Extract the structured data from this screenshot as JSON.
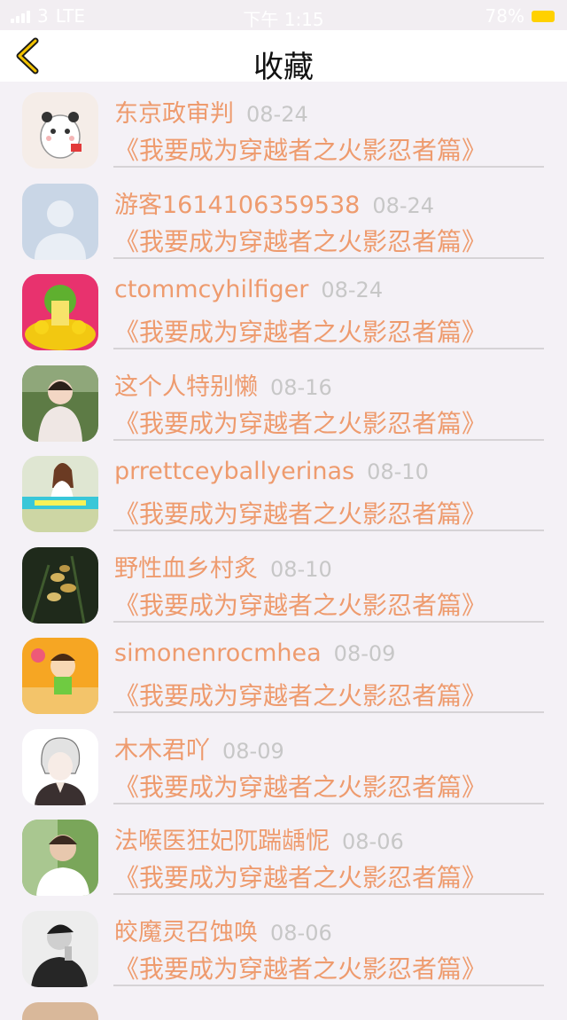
{
  "status": {
    "carrier": "3",
    "network": "LTE",
    "time": "下午 1:15",
    "battery": "78%"
  },
  "header": {
    "title": "收藏"
  },
  "colors": {
    "accent": "#ee9b6e",
    "date": "#c7c7c7",
    "battery": "#ffd100"
  },
  "items": [
    {
      "name": "东京政审判",
      "date": "08-24",
      "book": "《我要成为穿越者之火影忍者篇》",
      "avatar": "panda-sticker-avatar"
    },
    {
      "name": "游客1614106359538",
      "date": "08-24",
      "book": "《我要成为穿越者之火影忍者篇》",
      "avatar": "default-person-avatar"
    },
    {
      "name": "ctommcyhilfiger",
      "date": "08-24",
      "book": "《我要成为穿越者之火影忍者篇》",
      "avatar": "cartoon-plant-avatar"
    },
    {
      "name": "这个人特别懒",
      "date": "08-16",
      "book": "《我要成为穿越者之火影忍者篇》",
      "avatar": "girl-photo-avatar"
    },
    {
      "name": "prrettceyballyerinas",
      "date": "08-10",
      "book": "《我要成为穿越者之火影忍者篇》",
      "avatar": "girl-field-avatar"
    },
    {
      "name": "野性血乡村炙",
      "date": "08-10",
      "book": "《我要成为穿越者之火影忍者篇》",
      "avatar": "flower-avatar"
    },
    {
      "name": "simonenrocmhea",
      "date": "08-09",
      "book": "《我要成为穿越者之火影忍者篇》",
      "avatar": "cartoon-kid-avatar"
    },
    {
      "name": "木木君吖",
      "date": "08-09",
      "book": "《我要成为穿越者之火影忍者篇》",
      "avatar": "anime-boy-avatar"
    },
    {
      "name": "法喉医狂妃阢踹龋怩",
      "date": "08-06",
      "book": "《我要成为穿越者之火影忍者篇》",
      "avatar": "man-photo-avatar"
    },
    {
      "name": "皎魔灵召蚀唤",
      "date": "08-06",
      "book": "《我要成为穿越者之火影忍者篇》",
      "avatar": "bw-man-avatar"
    }
  ]
}
